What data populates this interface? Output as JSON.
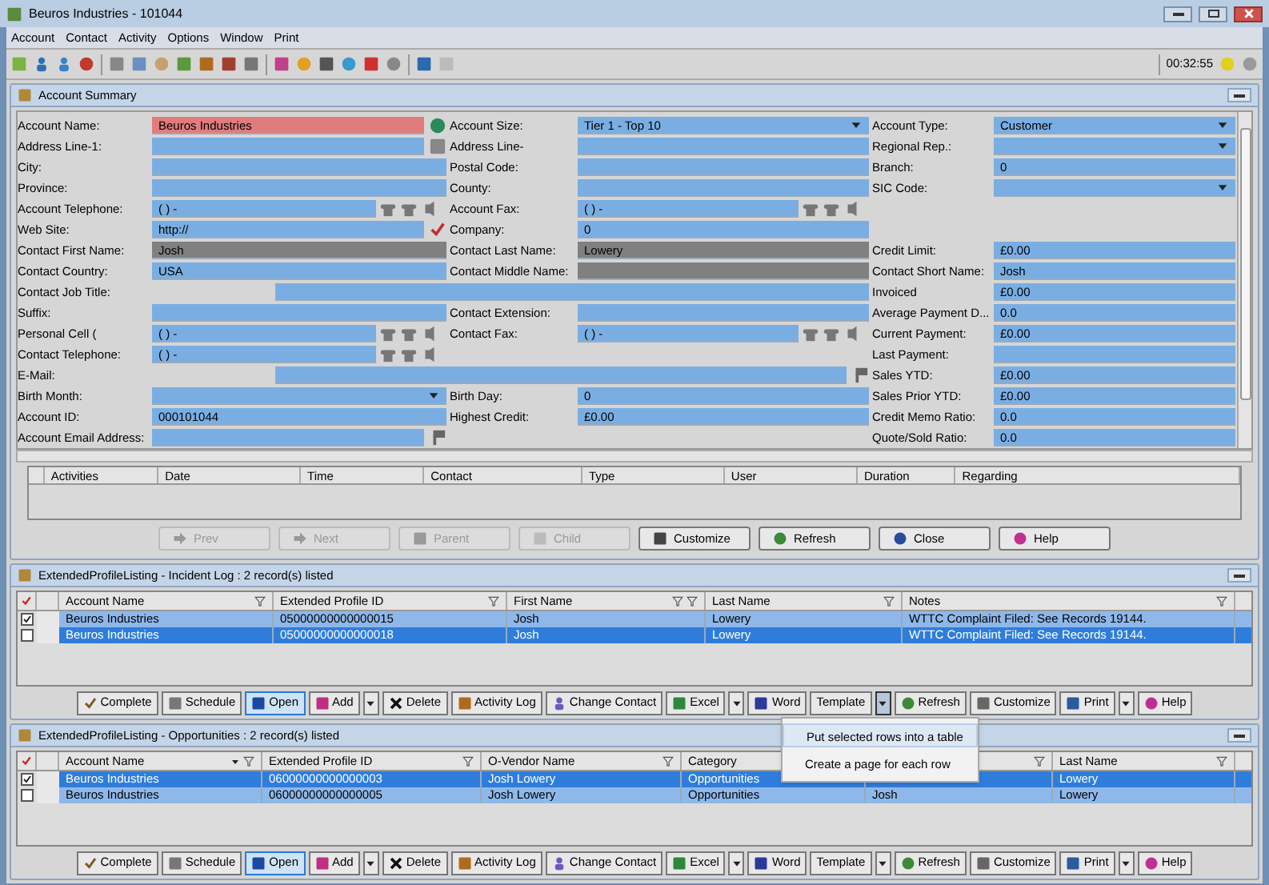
{
  "window": {
    "title": "Beuros Industries - 101044"
  },
  "menu": [
    "Account",
    "Contact",
    "Activity",
    "Options",
    "Window",
    "Print"
  ],
  "toolbar": {
    "timer": "00:32:55"
  },
  "summary": {
    "title": "Account Summary",
    "rows": [
      {
        "left": {
          "label": "Account Name:",
          "value": "Beuros Industries",
          "kind": "required"
        },
        "middle": {
          "label": "Account Size:",
          "value": "Tier 1 - Top 10",
          "kind": "dropdown"
        },
        "right": {
          "label": "Account Type:",
          "value": "Customer",
          "kind": "dropdown"
        }
      },
      {
        "left": {
          "label": "Address Line-1:",
          "kind": "address"
        },
        "middle": {
          "label": "Address Line-",
          "kind": "text"
        },
        "right": {
          "label": "Regional Rep.:",
          "kind": "dropdown"
        }
      },
      {
        "left": {
          "label": "City:",
          "kind": "text"
        },
        "middle": {
          "label": "Postal Code:",
          "kind": "text"
        },
        "right": {
          "label": "Branch:",
          "value": "0",
          "kind": "text"
        }
      },
      {
        "left": {
          "label": "Province:",
          "kind": "text"
        },
        "middle": {
          "label": "County:",
          "kind": "text"
        },
        "right": {
          "label": "SIC Code:",
          "kind": "dropdown"
        }
      },
      {
        "left": {
          "label": "Account Telephone:",
          "value": "(  )   -",
          "kind": "phone"
        },
        "middle": {
          "label": "Account Fax:",
          "value": "(  )   -",
          "kind": "phone"
        }
      },
      {
        "left": {
          "label": "Web Site:",
          "value": "http://",
          "kind": "web"
        },
        "middle": {
          "label": "Company:",
          "value": "0",
          "kind": "text"
        }
      },
      {
        "left": {
          "label": "Contact First Name:",
          "value": "Josh",
          "kind": "locked"
        },
        "middle": {
          "label": "Contact Last Name:",
          "value": "Lowery",
          "kind": "locked"
        },
        "right": {
          "label": "Credit Limit:",
          "value": "£0.00",
          "kind": "text"
        }
      },
      {
        "left": {
          "label": "Contact Country:",
          "value": "USA",
          "kind": "text"
        },
        "middle": {
          "label": "Contact Middle Name:",
          "kind": "locked"
        },
        "right": {
          "label": "Contact Short Name:",
          "value": "Josh",
          "kind": "text"
        }
      },
      {
        "left": {
          "label": "Contact Job Title:",
          "kind": "wide"
        },
        "right": {
          "label": "Invoiced",
          "value": "£0.00",
          "kind": "text"
        }
      },
      {
        "left": {
          "label": "Suffix:",
          "kind": "text"
        },
        "middle": {
          "label": "Contact Extension:",
          "kind": "text"
        },
        "right": {
          "label": "Average Payment D...",
          "value": "0.0",
          "kind": "text"
        }
      },
      {
        "left": {
          "label": "Personal Cell (",
          "value": "(  )   -",
          "kind": "phone"
        },
        "middle": {
          "label": "Contact Fax:",
          "value": "(  )   -",
          "kind": "phone"
        },
        "right": {
          "label": "Current Payment:",
          "value": "£0.00",
          "kind": "text"
        }
      },
      {
        "left": {
          "label": "Contact Telephone:",
          "value": "(  )   -",
          "kind": "phone"
        },
        "right": {
          "label": "Last Payment:",
          "kind": "text"
        }
      },
      {
        "left": {
          "label": "E-Mail:",
          "kind": "wide_email"
        },
        "right": {
          "label": "Sales YTD:",
          "value": "£0.00",
          "kind": "text"
        }
      },
      {
        "left": {
          "label": "Birth Month:",
          "kind": "dropdown"
        },
        "middle": {
          "label": "Birth Day:",
          "value": "0",
          "kind": "text"
        },
        "right": {
          "label": "Sales Prior YTD:",
          "value": "£0.00",
          "kind": "text"
        }
      },
      {
        "left": {
          "label": "Account ID:",
          "value": "000101044",
          "kind": "text"
        },
        "middle": {
          "label": "Highest Credit:",
          "value": "£0.00",
          "kind": "text"
        },
        "right": {
          "label": "Credit Memo Ratio:",
          "value": "0.0",
          "kind": "text"
        }
      },
      {
        "left": {
          "label": "Account Email Address:",
          "kind": "email"
        },
        "right": {
          "label": "Quote/Sold Ratio:",
          "value": "0.0",
          "kind": "text"
        }
      }
    ],
    "activity_columns": [
      "Activities",
      "Date",
      "Time",
      "Contact",
      "Type",
      "User",
      "Duration",
      "Regarding"
    ],
    "buttons": [
      {
        "label": "Prev",
        "disabled": true
      },
      {
        "label": "Next",
        "disabled": true
      },
      {
        "label": "Parent",
        "disabled": true
      },
      {
        "label": "Child",
        "disabled": true
      },
      {
        "label": "Customize",
        "disabled": false
      },
      {
        "label": "Refresh",
        "disabled": false
      },
      {
        "label": "Close",
        "disabled": false
      },
      {
        "label": "Help",
        "disabled": false
      }
    ]
  },
  "listings": [
    {
      "title": "ExtendedProfileListing - Incident Log : 2 record(s) listed",
      "columns": [
        {
          "label": "Account Name",
          "sorted": false,
          "filtered": false
        },
        {
          "label": "Extended Profile ID",
          "sorted": false,
          "filtered": false
        },
        {
          "label": "First Name",
          "sorted": false,
          "filtered": true
        },
        {
          "label": "Last Name",
          "sorted": false,
          "filtered": false
        },
        {
          "label": "Notes",
          "sorted": false,
          "filtered": false
        }
      ],
      "rows": [
        {
          "checked": true,
          "selected": false,
          "cells": [
            "Beuros Industries",
            "05000000000000015",
            "Josh",
            "Lowery",
            "WTTC Complaint Filed: See Records 19144."
          ]
        },
        {
          "checked": false,
          "selected": true,
          "cells": [
            "Beuros Industries",
            "05000000000000018",
            "Josh",
            "Lowery",
            "WTTC Complaint Filed: See Records 19144."
          ]
        }
      ],
      "buttons": [
        {
          "kind": "button",
          "label": "Complete",
          "highlighted": false
        },
        {
          "kind": "button",
          "label": "Schedule",
          "highlighted": false
        },
        {
          "kind": "button",
          "label": "Open",
          "highlighted": true
        },
        {
          "kind": "button",
          "label": "Add",
          "highlighted": false
        },
        {
          "kind": "caret",
          "open": false
        },
        {
          "kind": "button",
          "label": "Delete",
          "highlighted": false
        },
        {
          "kind": "button",
          "label": "Activity Log",
          "highlighted": false
        },
        {
          "kind": "button",
          "label": "Change Contact",
          "highlighted": false
        },
        {
          "kind": "button",
          "label": "Excel",
          "highlighted": false
        },
        {
          "kind": "caret",
          "open": false
        },
        {
          "kind": "button",
          "label": "Word",
          "highlighted": false
        },
        {
          "kind": "button",
          "label": "Template",
          "highlighted": false
        },
        {
          "kind": "caret",
          "open": true
        },
        {
          "kind": "button",
          "label": "Refresh",
          "highlighted": false
        },
        {
          "kind": "button",
          "label": "Customize",
          "highlighted": false
        },
        {
          "kind": "button",
          "label": "Print",
          "highlighted": false
        },
        {
          "kind": "caret",
          "open": false
        },
        {
          "kind": "button",
          "label": "Help",
          "highlighted": false
        }
      ]
    },
    {
      "title": "ExtendedProfileListing - Opportunities : 2 record(s) listed",
      "columns": [
        {
          "label": "Account Name",
          "sorted": true,
          "filtered": false
        },
        {
          "label": "Extended Profile ID",
          "sorted": false,
          "filtered": false
        },
        {
          "label": "O-Vendor Name",
          "sorted": false,
          "filtered": false
        },
        {
          "label": "Category"
        },
        {
          "sorted": false,
          "filtered": false
        },
        {
          "label": "Last Name",
          "sorted": false,
          "filtered": false
        }
      ],
      "rows": [
        {
          "checked": true,
          "selected": true,
          "cells": [
            "Beuros Industries",
            "06000000000000003",
            "Josh Lowery",
            "Opportunities",
            null,
            "Lowery"
          ]
        },
        {
          "checked": false,
          "selected": false,
          "cells": [
            "Beuros Industries",
            "06000000000000005",
            "Josh Lowery",
            "Opportunities",
            "Josh",
            "Lowery"
          ]
        }
      ],
      "buttons": [
        {
          "kind": "button",
          "label": "Complete",
          "highlighted": false
        },
        {
          "kind": "button",
          "label": "Schedule",
          "highlighted": false
        },
        {
          "kind": "button",
          "label": "Open",
          "highlighted": true
        },
        {
          "kind": "button",
          "label": "Add",
          "highlighted": false
        },
        {
          "kind": "caret",
          "open": false
        },
        {
          "kind": "button",
          "label": "Delete",
          "highlighted": false
        },
        {
          "kind": "button",
          "label": "Activity Log",
          "highlighted": false
        },
        {
          "kind": "button",
          "label": "Change Contact",
          "highlighted": false
        },
        {
          "kind": "button",
          "label": "Excel",
          "highlighted": false
        },
        {
          "kind": "caret",
          "open": false
        },
        {
          "kind": "button",
          "label": "Word",
          "highlighted": false
        },
        {
          "kind": "button",
          "label": "Template",
          "highlighted": false
        },
        {
          "kind": "caret",
          "open": false
        },
        {
          "kind": "button",
          "label": "Refresh",
          "highlighted": false
        },
        {
          "kind": "button",
          "label": "Customize",
          "highlighted": false
        },
        {
          "kind": "button",
          "label": "Print",
          "highlighted": false
        },
        {
          "kind": "caret",
          "open": false
        },
        {
          "kind": "button",
          "label": "Help",
          "highlighted": false
        }
      ]
    }
  ],
  "template_menu": {
    "items": [
      {
        "label": "Put selected rows into a table",
        "selected": true
      },
      {
        "label": "Create a page for each row",
        "selected": false
      }
    ]
  }
}
